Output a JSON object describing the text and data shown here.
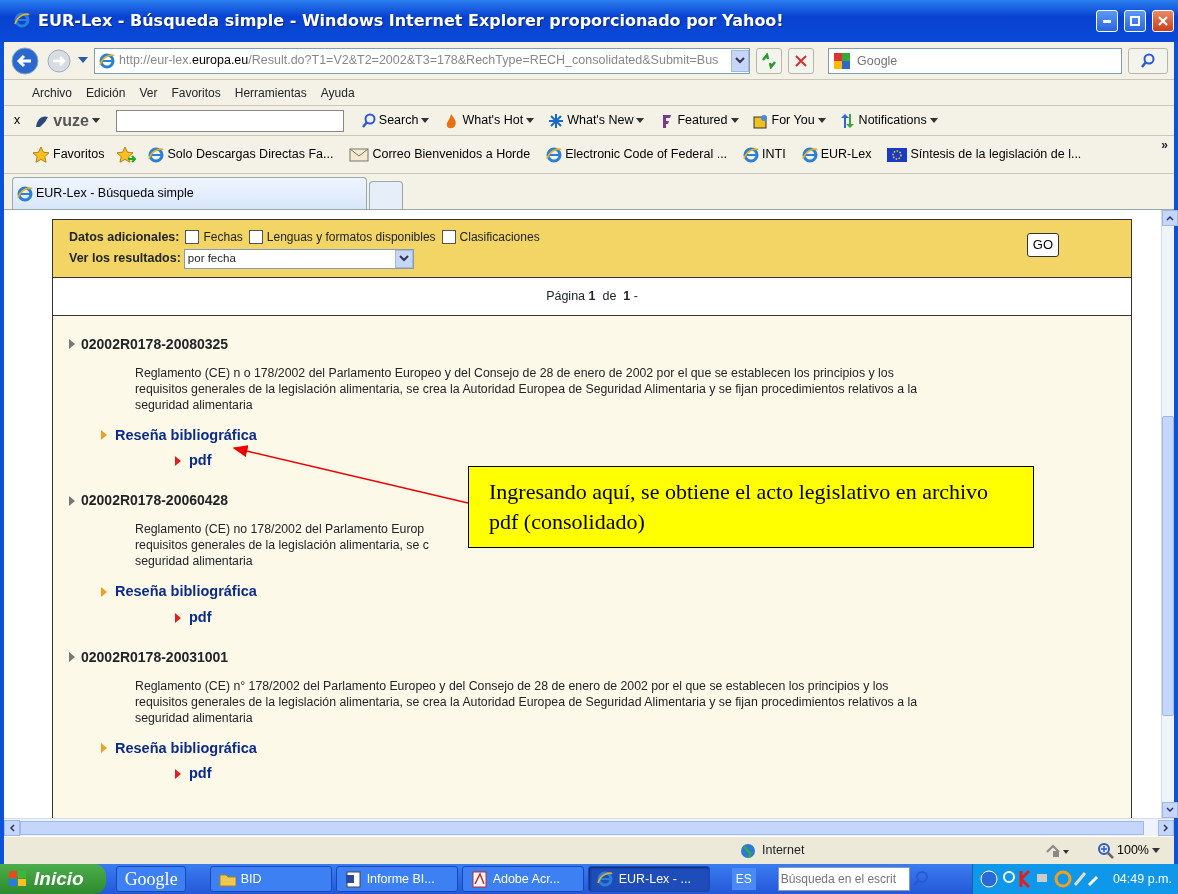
{
  "window": {
    "title": "EUR-Lex - Búsqueda simple - Windows Internet Explorer proporcionado por Yahoo!"
  },
  "address_bar": {
    "url_prefix": "http://eur-lex.",
    "url_domain": "europa.eu",
    "url_rest": "/Result.do?T1=V2&T2=2002&T3=178&RechType=RECH_consolidated&Submit=Bus",
    "search_placeholder": "Google"
  },
  "menu": [
    "Archivo",
    "Edición",
    "Ver",
    "Favoritos",
    "Herramientas",
    "Ayuda"
  ],
  "toolbar": {
    "close": "x",
    "brand": "vuze",
    "items": [
      "Search",
      "What's Hot",
      "What's New",
      "Featured",
      "For You",
      "Notifications"
    ]
  },
  "favorites_bar": {
    "label": "Favoritos",
    "links": [
      {
        "label": "Solo Descargas Directas Fa...",
        "kind": "page"
      },
      {
        "label": "Correo  Bienvenidos a Horde",
        "kind": "mail"
      },
      {
        "label": "Electronic Code of Federal ...",
        "kind": "page"
      },
      {
        "label": "INTI",
        "kind": "page"
      },
      {
        "label": "EUR-Lex",
        "kind": "page"
      },
      {
        "label": "Síntesis de la legislación de l...",
        "kind": "eu"
      }
    ],
    "overflow": "»"
  },
  "tabs": [
    {
      "label": "EUR-Lex - Búsqueda simple",
      "selected": true
    }
  ],
  "options": {
    "extra_label": "Datos adicionales:",
    "checkboxes": [
      {
        "label": "Fechas",
        "checked": false
      },
      {
        "label": "Lenguas y formatos disponibles",
        "checked": false
      },
      {
        "label": "Clasificaciones",
        "checked": false
      }
    ],
    "sort_label": "Ver los resultados:",
    "sort_value": "por fecha",
    "go": "GO"
  },
  "pagination": "Página **1**  de  **1** -",
  "results": [
    {
      "id": "02002R0178-20080325",
      "lines": [
        "Reglamento (CE) n o 178/2002 del Parlamento Europeo y del Consejo de 28 de enero de 2002 por el que se establecen los principios y los",
        "requisitos generales de la legislación alimentaria, se crea la Autoridad Europea de Seguridad Alimentaria y se fijan procedimientos relativos a la",
        "seguridad alimentaria"
      ],
      "bibliography": "Reseña bibliográfica",
      "pdf": "pdf"
    },
    {
      "id": "02002R0178-20060428",
      "lines": [
        "Reglamento (CE) no 178/2002 del Parlamento Europ",
        "requisitos generales de la legislación alimentaria, se c",
        "seguridad alimentaria"
      ],
      "bibliography": "Reseña bibliográfica",
      "pdf": "pdf"
    },
    {
      "id": "02002R0178-20031001",
      "lines": [
        "Reglamento (CE) n° 178/2002 del Parlamento Europeo y del Consejo de 28 de enero de 2002 por el que se establecen los principios y los",
        "requisitos generales de la legislación alimentaria, se crea la Autoridad Europea de Seguridad Alimentaria y se fijan procedimientos relativos a la",
        "seguridad alimentaria"
      ],
      "bibliography": "Reseña bibliográfica",
      "pdf": "pdf"
    }
  ],
  "callout": "Ingresando aquí, se obtiene el acto legislativo en archivo pdf (consolidado)",
  "status_bar": {
    "zone": "Internet",
    "zoom": "100%"
  },
  "taskbar": {
    "start": "Inicio",
    "google": "Google",
    "buttons": [
      {
        "label": "BID",
        "kind": "folder",
        "selected": false
      },
      {
        "label": "Informe BI...",
        "kind": "word",
        "selected": false
      },
      {
        "label": "Adobe Acr...",
        "kind": "pdf",
        "selected": false
      },
      {
        "label": "EUR-Lex - ...",
        "kind": "ie",
        "selected": true
      }
    ],
    "language": "ES",
    "search_placeholder": "Búsqueda en el escrit",
    "clock": "04:49 p.m."
  }
}
